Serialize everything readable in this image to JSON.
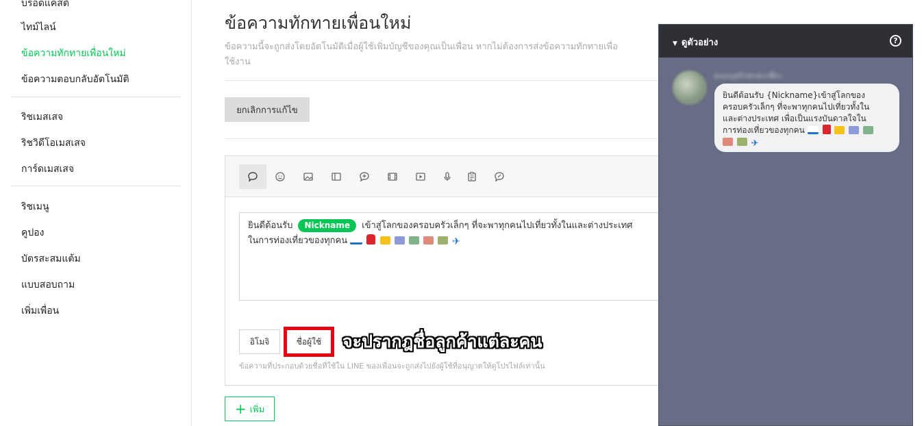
{
  "sidebar": {
    "items": [
      {
        "label": "ไทม์ไลน์",
        "active": false
      },
      {
        "label": "ข้อความทักทายเพื่อนใหม่",
        "active": true
      },
      {
        "label": "ข้อความตอบกลับอัตโนมัติ",
        "active": false
      },
      {
        "label": "ริชเมสเสจ",
        "active": false
      },
      {
        "label": "ริชวิดีโอเมสเสจ",
        "active": false
      },
      {
        "label": "การ์ดเมสเสจ",
        "active": false
      },
      {
        "label": "ริชเมนู",
        "active": false
      },
      {
        "label": "คูปอง",
        "active": false
      },
      {
        "label": "บัตรสะสมแต้ม",
        "active": false
      },
      {
        "label": "แบบสอบถาม",
        "active": false
      },
      {
        "label": "เพิ่มเพื่อน",
        "active": false
      }
    ]
  },
  "header": {
    "title": "ข้อความทักทายเพื่อนใหม่",
    "description_line1": "ข้อความนี้จะถูกส่งโดยอัตโนมัติเมื่อผู้ใช้เพิ่มบัญชีของคุณเป็นเพื่อน หากไม่ต้องการส่งข้อความทักทายเพื่อ",
    "description_line2": "ใช้งาน"
  },
  "cancel_edit_label": "ยกเลิกการแก้ไข",
  "toolbar": {
    "tools": [
      "text-icon",
      "sticker-icon",
      "image-icon",
      "card-icon",
      "coupon-icon",
      "video-icon",
      "play-icon",
      "audio-icon",
      "survey-icon",
      "rich-message-icon"
    ]
  },
  "message": {
    "prefix": "ยินดีต้อนรับ",
    "nickname_tag": "Nickname",
    "line1_rest": "เข้าสู่โลกของครอบครัวเล็กๆ ที่จะพาทุกคนไปเที่ยวทั้งในและต่างประเทศ",
    "line2": "ในการท่องเที่ยวของทุกคน"
  },
  "emoji_button_label": "อิโมจิ",
  "nickname_button_label": "ชื่อผู้ใช้",
  "annotation_text": "จะปรากฎชื่อลูกค้าแต่ละคน",
  "editor_note": "ข้อความที่ประกอบด้วยชื่อที่ใช้ใน LINE ของเพื่อนจะถูกส่งไปยังผู้ใช้ที่อนุญาตให้ดูโปรไฟล์เท่านั้น",
  "add_button_label": "เพิ่ม",
  "preview": {
    "title": "ดูตัวอย่าง",
    "help": "?",
    "sender_name": "ดนมนครัวขบพาเที่ยว",
    "bubble_lines": [
      "ยินดีต้อนรับ {Nickname}เข้าสู่โลกของ",
      "ครอบครัวเล็กๆ ที่จะพาทุกคนไปเที่ยวทั้งใน",
      "และต่างประเทศ เพื่อเป็นแรงบันดาลใจใน",
      "การท่องเที่ยวของทุกคน"
    ]
  },
  "colors": {
    "line_green": "#06c755",
    "highlight_red": "#e60012",
    "preview_bg": "#666d84",
    "preview_header": "#2e3035"
  }
}
